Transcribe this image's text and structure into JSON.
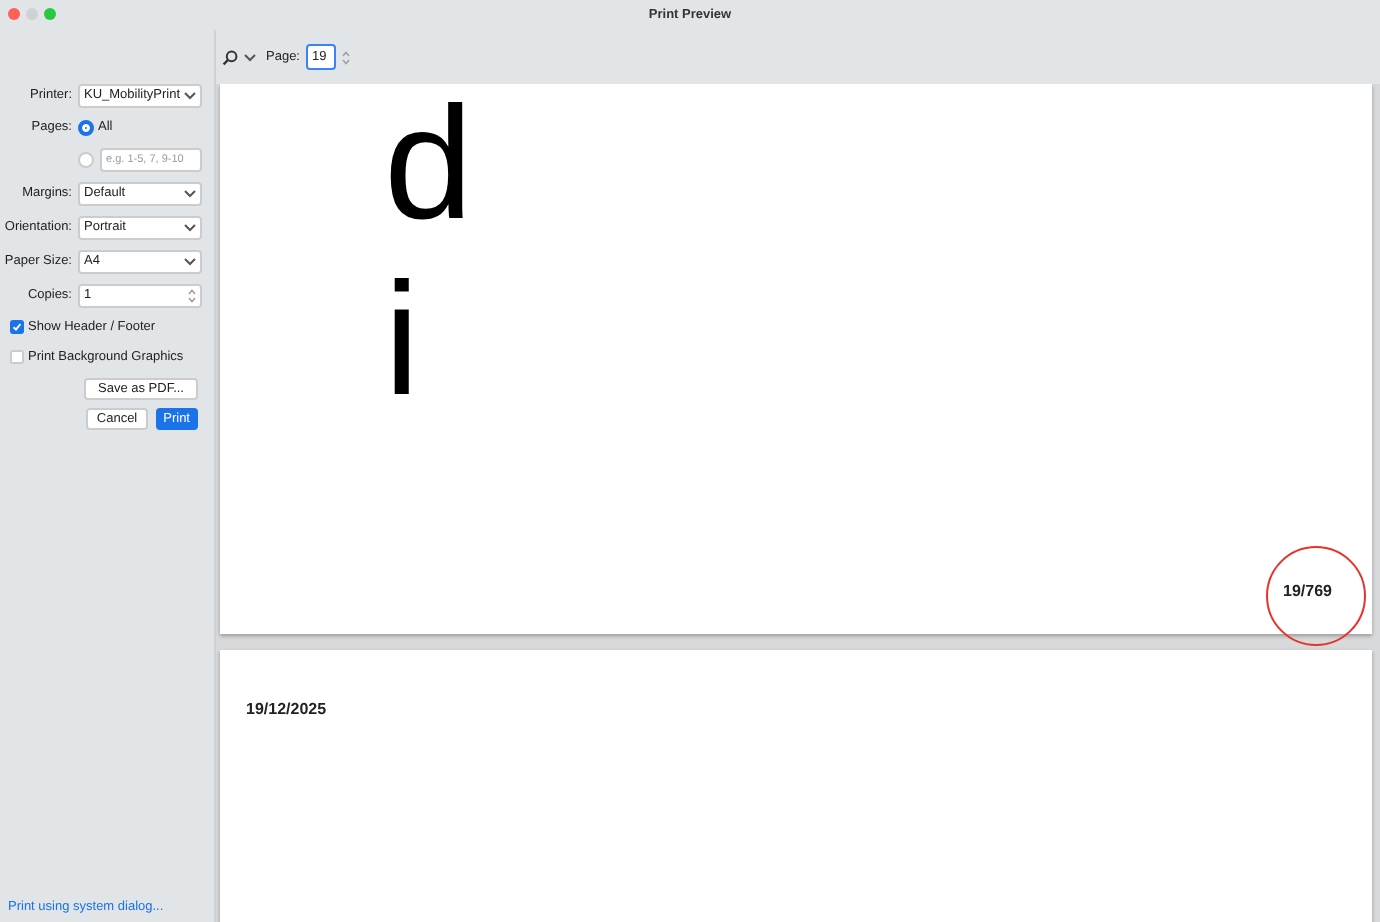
{
  "window": {
    "title": "Print Preview"
  },
  "toolbar": {
    "page_label": "Page:",
    "page_value": "19"
  },
  "settings": [
    {
      "kind": "select",
      "label": "Printer:",
      "value": "KU_MobilityPrint"
    },
    {
      "kind": "radio",
      "label": "Pages:",
      "value": "All",
      "selected": true
    },
    {
      "kind": "radio-field",
      "placeholder": "e.g. 1-5, 7, 9-10",
      "selected": false
    },
    {
      "kind": "select",
      "label": "Margins:",
      "value": "Default"
    },
    {
      "kind": "select",
      "label": "Orientation:",
      "value": "Portrait"
    },
    {
      "kind": "select",
      "label": "Paper Size:",
      "value": "A4"
    },
    {
      "kind": "stepper",
      "label": "Copies:",
      "value": "1"
    },
    {
      "kind": "checkbox",
      "label": "Show Header / Footer",
      "checked": true
    },
    {
      "kind": "checkbox",
      "label": "Print Background Graphics",
      "checked": false
    }
  ],
  "buttons": {
    "save_pdf": "Save as PDF...",
    "cancel": "Cancel",
    "print": "Print"
  },
  "system_dialog_link": "Print using system dialog...",
  "pages": [
    {
      "glyphs": [
        "d",
        "i"
      ],
      "footer": "19/769",
      "footer_circled": true
    },
    {
      "header": "19/12/2025"
    }
  ]
}
